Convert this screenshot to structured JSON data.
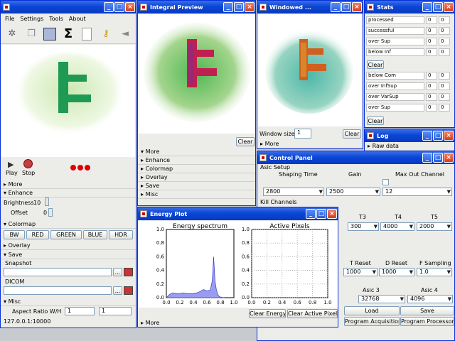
{
  "main_window": {
    "menu": [
      "File",
      "Settings",
      "Tools",
      "About"
    ],
    "toolbar_icons": [
      "pinwheel-icon",
      "copy-icon",
      "save-image-icon",
      "sigma-icon",
      "document-icon",
      "key-icon",
      "speaker-icon"
    ],
    "play_label": "Play",
    "stop_label": "Stop",
    "more_label": "More",
    "enhance_label": "Enhance",
    "brightness_label": "Brightness",
    "brightness_value": "10",
    "offset_label": "Offset",
    "offset_value": "0",
    "colormap_label": "Colormap",
    "colormap_buttons": [
      "BW",
      "RED",
      "GREEN",
      "BLUE",
      "HDR"
    ],
    "overlay_label": "Overlay",
    "save_label": "Save",
    "snapshot_label": "Snapshot",
    "dicom_label": "DICOM",
    "browse_label": "...",
    "misc_label": "Misc",
    "aspect_label": "Aspect Ratio W/H",
    "aspect_w": "1",
    "aspect_h": "1",
    "status": "127.0.0.1:10000"
  },
  "integral_window": {
    "title": "Integral Preview",
    "clear_label": "Clear",
    "sections": [
      "More",
      "Enhance",
      "Colormap",
      "Overlay",
      "Save",
      "Misc"
    ]
  },
  "windowed_window": {
    "title": "Windowed ...",
    "window_size_label": "Window size",
    "window_size_value": "1",
    "clear_label": "Clear",
    "more_label": "More"
  },
  "stats_window": {
    "title": "Stats",
    "rows_top": [
      "processed",
      "successful",
      "over Sup",
      "below Inf"
    ],
    "rows_bottom": [
      "below Com",
      "over InfSup",
      "over VarSup",
      "over Sup"
    ],
    "cell_value": "0",
    "clear_label": "Clear"
  },
  "log_window": {
    "title": "Log",
    "raw_data_label": "Raw data"
  },
  "control_window": {
    "title": "Control Panel",
    "asic_setup_label": "Asic Setup",
    "shaping_time_label": "Shaping Time",
    "gain_label": "Gain",
    "max_out_label": "Max Out Channel",
    "shaping_time_value": "2800",
    "gain_value": "2500",
    "max_out_value": "12",
    "kill_channels_label": "Kill Channels",
    "t_labels": [
      "T3",
      "T4",
      "T5"
    ],
    "t_values": [
      "300",
      "4000",
      "2000"
    ],
    "reset_labels": [
      "T Reset",
      "D Reset",
      "F Sampling"
    ],
    "reset_values": [
      "1000",
      "1000",
      "1.0"
    ],
    "asic3_label": "Asic 3",
    "asic4_label": "Asic 4",
    "asic3_value": "32768",
    "asic4_value": "4096",
    "load_label": "Load",
    "save_label": "Save",
    "program_acq_label": "Program Acquisition",
    "program_proc_label": "Program Processor"
  },
  "energy_window": {
    "title": "Energy Plot",
    "clear_energy_label": "Clear Energy",
    "clear_active_label": "Clear Active Pixels",
    "more_label": "More"
  },
  "chart_data": [
    {
      "type": "area",
      "title": "Energy spectrum",
      "x": [
        0.0,
        0.05,
        0.1,
        0.15,
        0.2,
        0.25,
        0.3,
        0.35,
        0.4,
        0.45,
        0.5,
        0.55,
        0.6,
        0.65,
        0.68,
        0.7,
        0.72,
        0.74,
        0.76,
        0.78,
        0.8,
        0.85
      ],
      "y": [
        0.0,
        0.05,
        0.07,
        0.06,
        0.06,
        0.07,
        0.06,
        0.06,
        0.06,
        0.07,
        0.09,
        0.12,
        0.1,
        0.11,
        0.25,
        0.6,
        0.25,
        0.12,
        0.05,
        0.02,
        0.01,
        0.0
      ],
      "xlim": [
        0,
        1
      ],
      "ylim": [
        0,
        1
      ],
      "xticks": [
        "0.0",
        "0.2",
        "0.4",
        "0.6",
        "0.8",
        "1.0"
      ],
      "yticks": [
        "0.0",
        "0.2",
        "0.4",
        "0.6",
        "0.8",
        "1.0"
      ],
      "grid": false,
      "color": "#9a9cf0"
    },
    {
      "type": "scatter",
      "title": "Active Pixels",
      "x": [],
      "y": [],
      "xlim": [
        0,
        1
      ],
      "ylim": [
        0,
        1
      ],
      "xticks": [
        "0.0",
        "0.2",
        "0.4",
        "0.6",
        "0.8",
        "1.0"
      ],
      "yticks": [
        "0.0",
        "0.2",
        "0.4",
        "0.6",
        "0.8",
        "1.0"
      ],
      "grid": true
    }
  ]
}
